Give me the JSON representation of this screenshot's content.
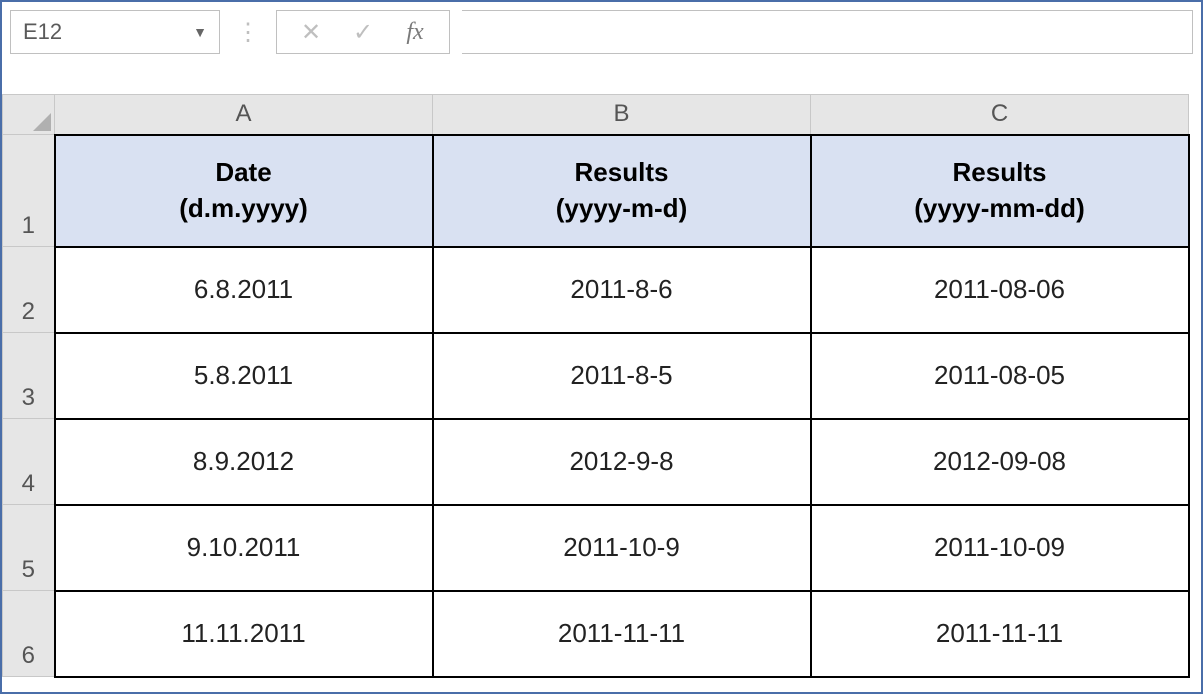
{
  "formula_bar": {
    "cell_ref": "E12",
    "formula_value": "",
    "fx_label": "fx",
    "cancel_glyph": "✕",
    "enter_glyph": "✓"
  },
  "columns": [
    "A",
    "B",
    "C"
  ],
  "row_numbers": [
    "1",
    "2",
    "3",
    "4",
    "5",
    "6"
  ],
  "table": {
    "headers": [
      {
        "line1": "Date",
        "line2": "(d.m.yyyy)"
      },
      {
        "line1": "Results",
        "line2": "(yyyy-m-d)"
      },
      {
        "line1": "Results",
        "line2": "(yyyy-mm-dd)"
      }
    ],
    "rows": [
      {
        "a": "6.8.2011",
        "b": "2011-8-6",
        "c": "2011-08-06"
      },
      {
        "a": "5.8.2011",
        "b": "2011-8-5",
        "c": "2011-08-05"
      },
      {
        "a": "8.9.2012",
        "b": "2012-9-8",
        "c": "2012-09-08"
      },
      {
        "a": "9.10.2011",
        "b": "2011-10-9",
        "c": "2011-10-09"
      },
      {
        "a": "11.11.2011",
        "b": "2011-11-11",
        "c": "2011-11-11"
      }
    ]
  }
}
